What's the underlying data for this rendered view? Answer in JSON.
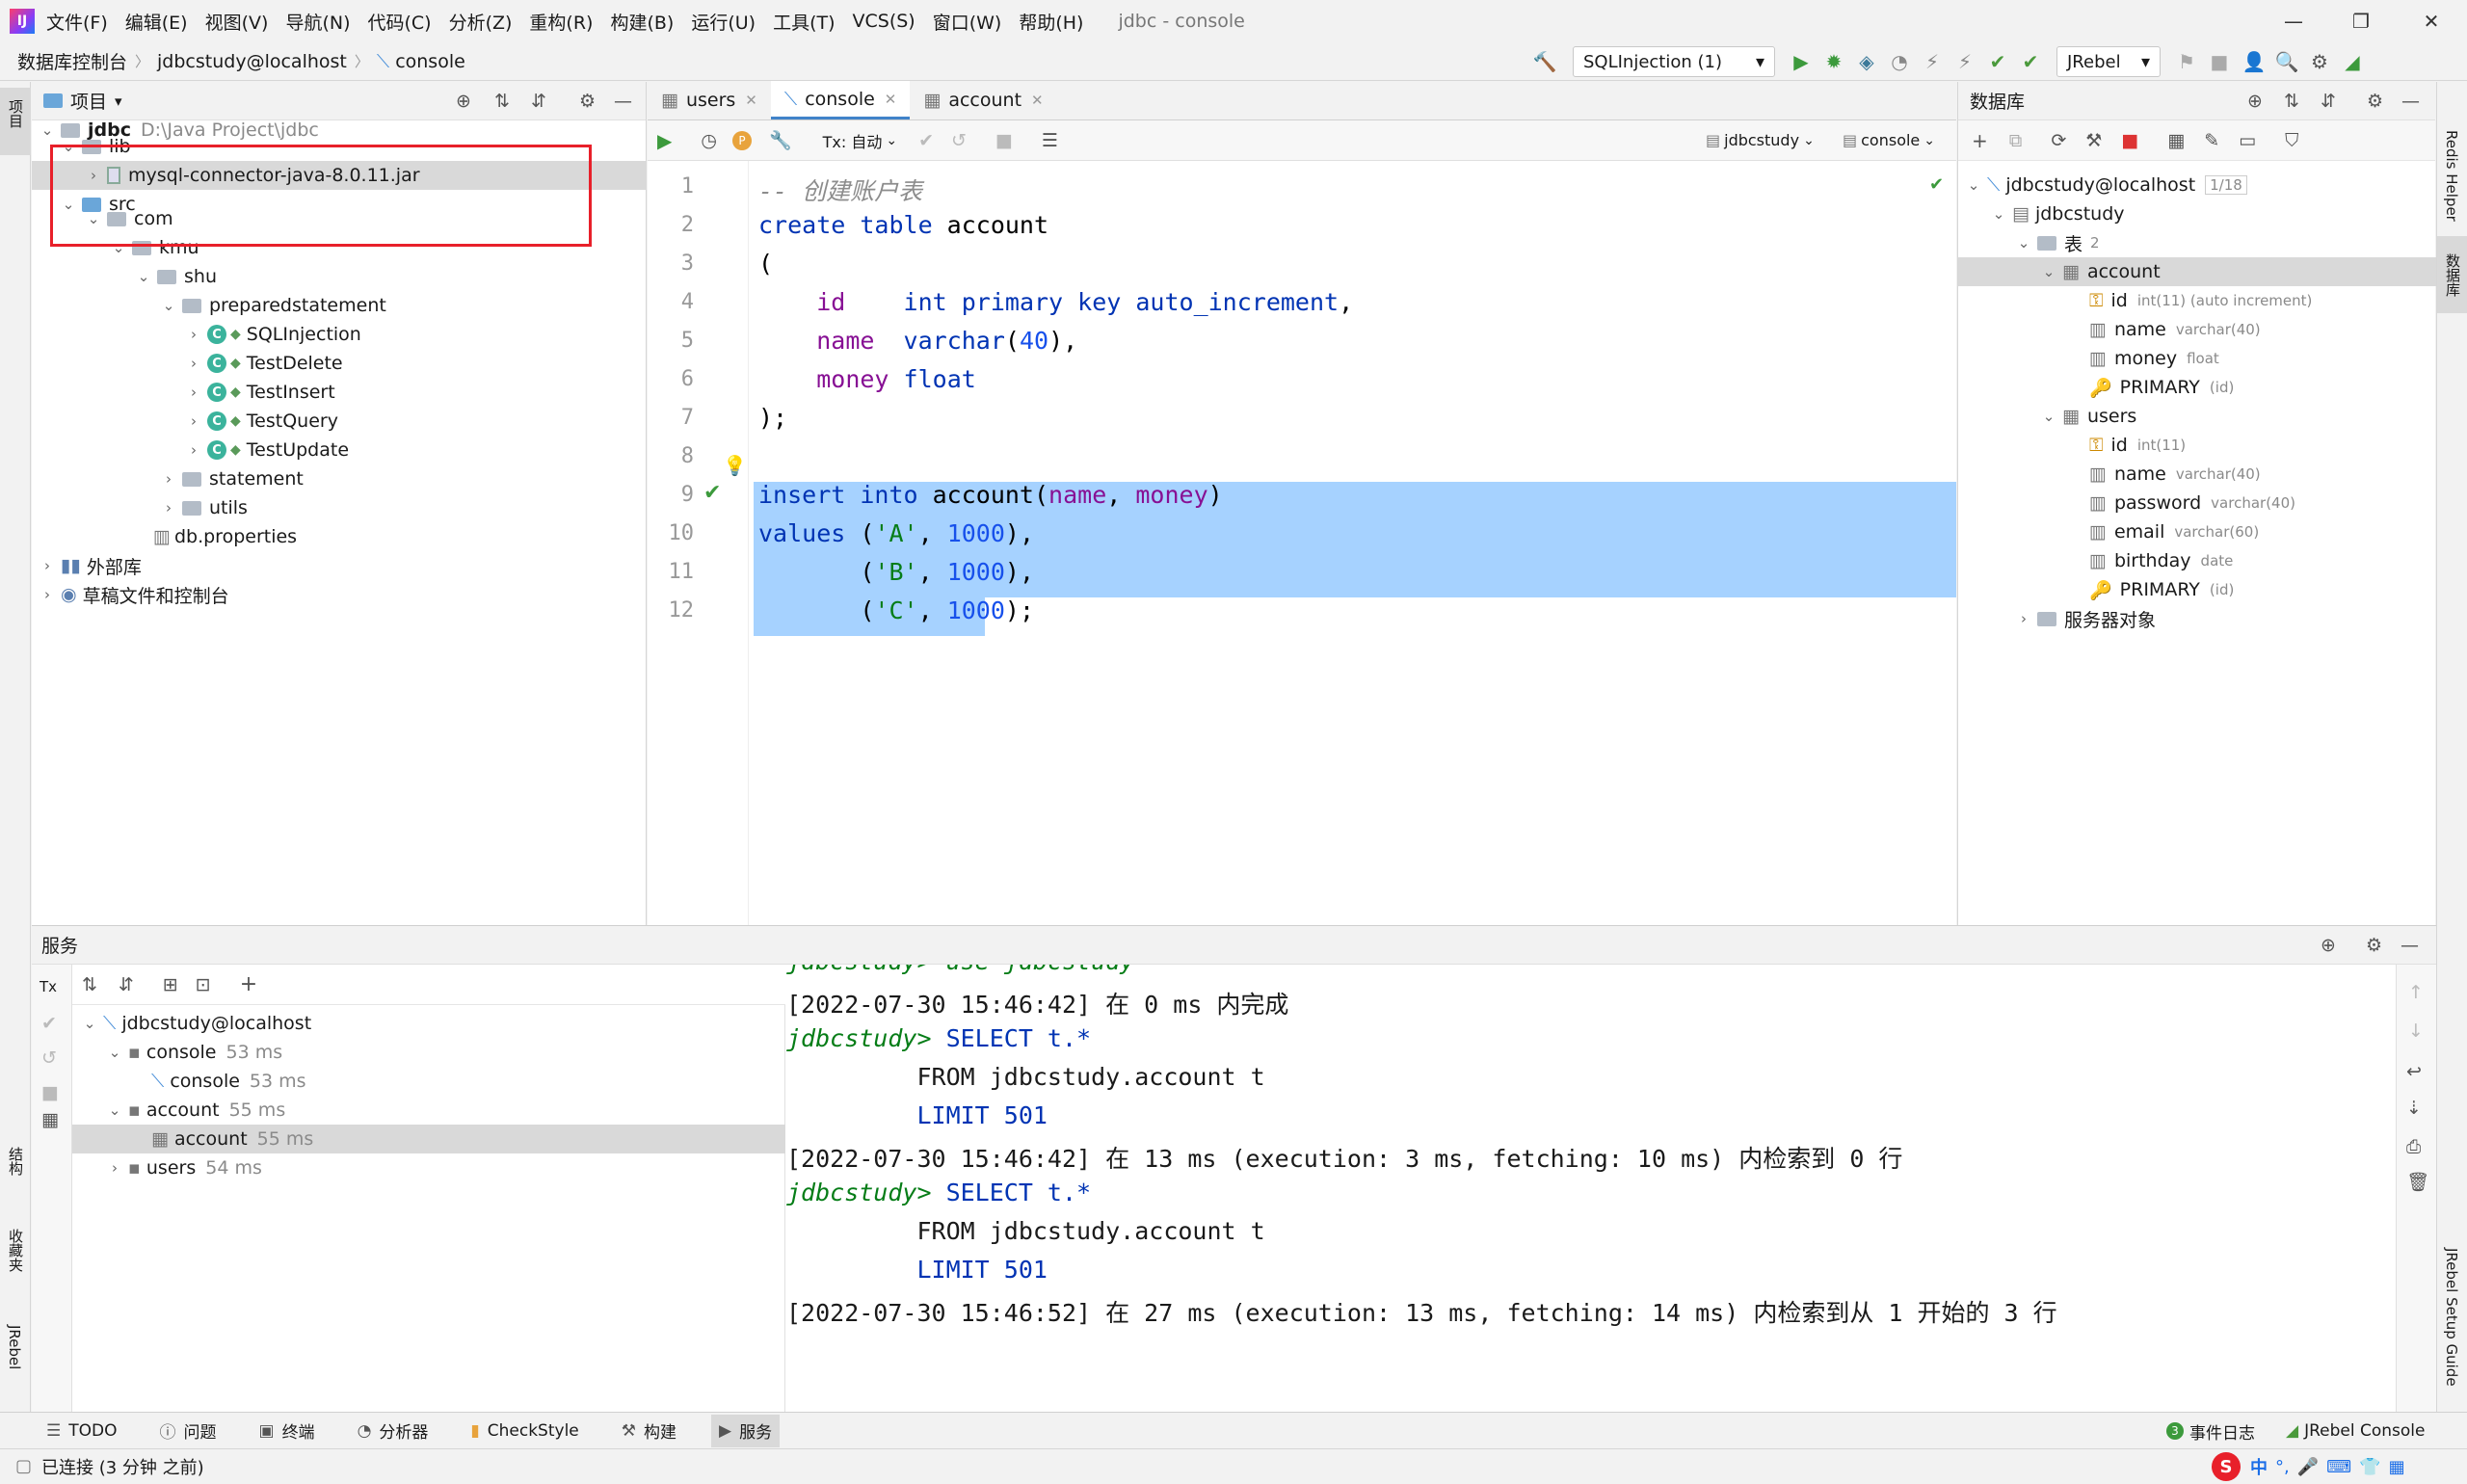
{
  "window": {
    "title": "jdbc - console",
    "logo": "IJ"
  },
  "menu": [
    "文件(F)",
    "编辑(E)",
    "视图(V)",
    "导航(N)",
    "代码(C)",
    "分析(Z)",
    "重构(R)",
    "构建(B)",
    "运行(U)",
    "工具(T)",
    "VCS(S)",
    "窗口(W)",
    "帮助(H)"
  ],
  "breadcrumbs": [
    "数据库控制台",
    "jdbcstudy@localhost",
    "console"
  ],
  "toolbar": {
    "run_config": "SQLInjection (1)",
    "jrebel": "JRebel"
  },
  "left_strip": {
    "project": "项目",
    "structure": "结构",
    "favorites": "收藏夹",
    "jrebel": "JRebel"
  },
  "right_strip": {
    "redis": "Redis Helper",
    "database": "数据库",
    "jrebel_guide": "JRebel Setup Guide"
  },
  "project": {
    "header": "项目",
    "root_name": "jdbc",
    "root_path": "D:\\Java Project\\jdbc",
    "items": [
      {
        "label": "lib"
      },
      {
        "label": "mysql-connector-java-8.0.11.jar"
      },
      {
        "label": "src"
      },
      {
        "label": "com"
      },
      {
        "label": "kmu"
      },
      {
        "label": "shu"
      },
      {
        "label": "preparedstatement"
      },
      {
        "label": "SQLInjection"
      },
      {
        "label": "TestDelete"
      },
      {
        "label": "TestInsert"
      },
      {
        "label": "TestQuery"
      },
      {
        "label": "TestUpdate"
      },
      {
        "label": "statement"
      },
      {
        "label": "utils"
      },
      {
        "label": "db.properties"
      },
      {
        "label": "外部库"
      },
      {
        "label": "草稿文件和控制台"
      }
    ]
  },
  "editor": {
    "tabs": [
      "users",
      "console",
      "account"
    ],
    "tx_mode": "Tx: 自动",
    "schema_select": "jdbcstudy",
    "console_select": "console",
    "line_numbers": [
      "1",
      "2",
      "3",
      "4",
      "5",
      "6",
      "7",
      "8",
      "9",
      "10",
      "11",
      "12"
    ]
  },
  "database": {
    "header": "数据库",
    "connection": "jdbcstudy@localhost",
    "counter": "1/18",
    "schema": "jdbcstudy",
    "tables_label": "表",
    "tables_count": "2",
    "account": {
      "name": "account",
      "columns": [
        {
          "name": "id",
          "type": "int(11) (auto increment)"
        },
        {
          "name": "name",
          "type": "varchar(40)"
        },
        {
          "name": "money",
          "type": "float"
        },
        {
          "name": "PRIMARY",
          "type": "(id)"
        }
      ]
    },
    "users": {
      "name": "users",
      "columns": [
        {
          "name": "id",
          "type": "int(11)"
        },
        {
          "name": "name",
          "type": "varchar(40)"
        },
        {
          "name": "password",
          "type": "varchar(40)"
        },
        {
          "name": "email",
          "type": "varchar(60)"
        },
        {
          "name": "birthday",
          "type": "date"
        },
        {
          "name": "PRIMARY",
          "type": "(id)"
        }
      ]
    },
    "server_objects": "服务器对象"
  },
  "services": {
    "header": "服务",
    "tree": [
      {
        "label": "jdbcstudy@localhost",
        "time": ""
      },
      {
        "label": "console",
        "time": "53 ms"
      },
      {
        "label": "console",
        "time": "53 ms"
      },
      {
        "label": "account",
        "time": "55 ms"
      },
      {
        "label": "account",
        "time": "55 ms"
      },
      {
        "label": "users",
        "time": "54 ms"
      }
    ],
    "output": {
      "l0": "jdbcstudy> use jdbcstudy",
      "l1": "[2022-07-30 15:46:42] 在 0 ms 内完成",
      "p2": "jdbcstudy>",
      "l2": " SELECT t.*",
      "l3": "         FROM jdbcstudy.account t",
      "l4": "         LIMIT 501",
      "l5": "[2022-07-30 15:46:42] 在 13 ms (execution: 3 ms, fetching: 10 ms) 内检索到 0 行",
      "p6": "jdbcstudy>",
      "l6": " SELECT t.*",
      "l7": "         FROM jdbcstudy.account t",
      "l8": "         LIMIT 501",
      "l9": "[2022-07-30 15:46:52] 在 27 ms (execution: 13 ms, fetching: 14 ms) 内检索到从 1 开始的 3 行"
    }
  },
  "bottom_tools": [
    "TODO",
    "问题",
    "终端",
    "分析器",
    "CheckStyle",
    "构建",
    "服务"
  ],
  "event_log": "事件日志",
  "event_count": "3",
  "jrebel_console": "JRebel Console",
  "status": "已连接 (3 分钟 之前)",
  "ime": "中"
}
